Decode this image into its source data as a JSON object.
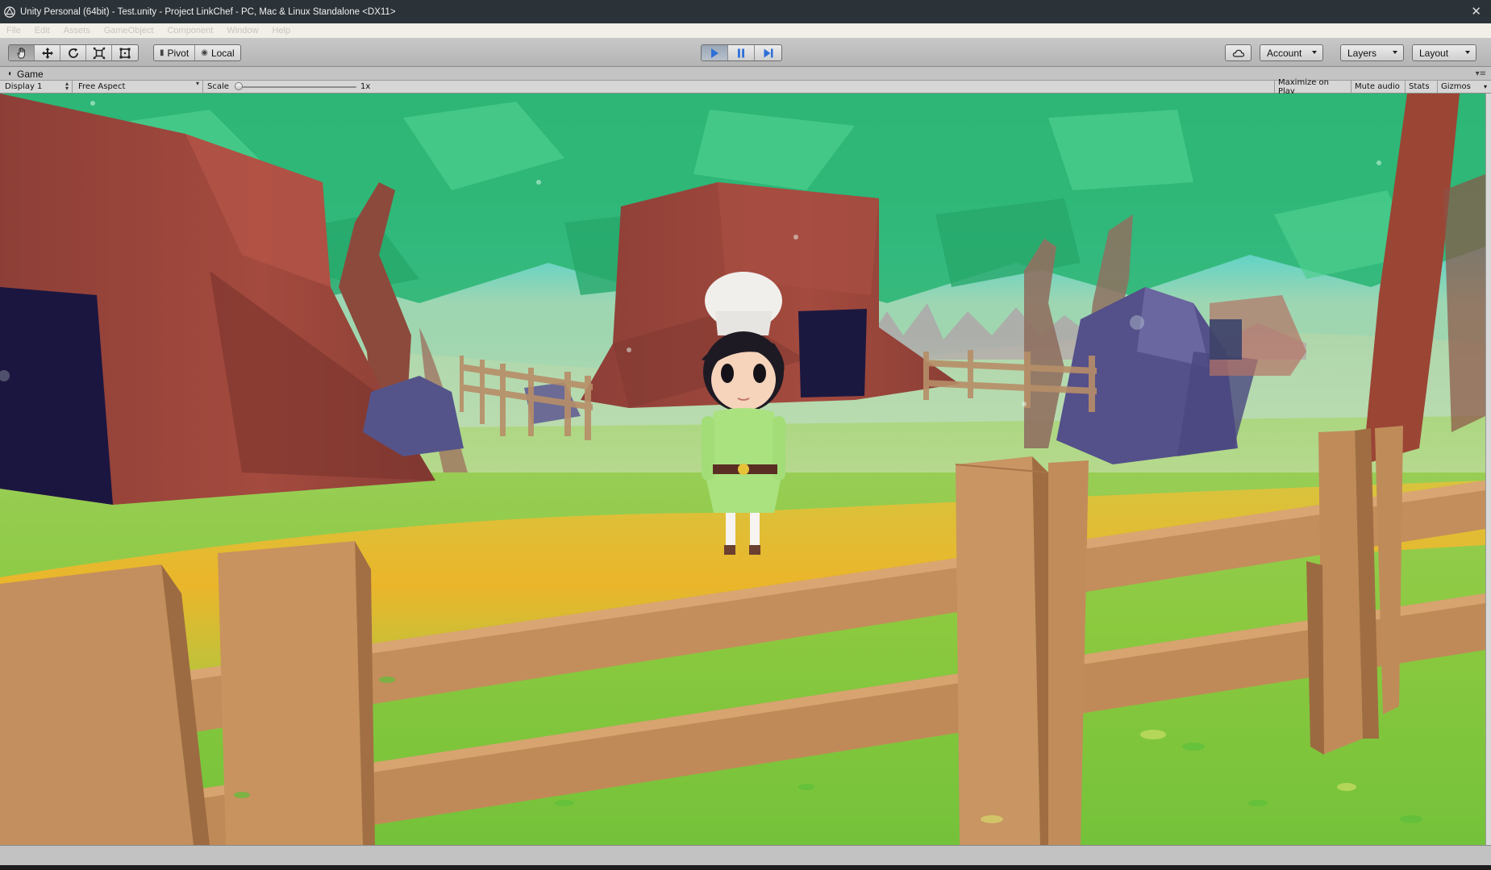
{
  "window": {
    "title": "Unity Personal (64bit) - Test.unity - Project LinkChef - PC, Mac & Linux Standalone <DX11>",
    "close_glyph": "✕"
  },
  "menu": {
    "items": [
      {
        "label": "File"
      },
      {
        "label": "Edit"
      },
      {
        "label": "Assets"
      },
      {
        "label": "GameObject"
      },
      {
        "label": "Component"
      },
      {
        "label": "Window"
      },
      {
        "label": "Help"
      }
    ]
  },
  "toolbar": {
    "tools": [
      {
        "name": "hand-tool",
        "icon": "hand-icon",
        "active": true
      },
      {
        "name": "move-tool",
        "icon": "move-icon",
        "active": false
      },
      {
        "name": "rotate-tool",
        "icon": "rotate-icon",
        "active": false
      },
      {
        "name": "scale-tool",
        "icon": "scale-icon",
        "active": false
      },
      {
        "name": "rect-tool",
        "icon": "rect-icon",
        "active": false
      }
    ],
    "pivot_label": "Pivot",
    "local_label": "Local",
    "play": {
      "playing": true,
      "accent": "#2e6fd8"
    },
    "account_label": "Account",
    "layers_label": "Layers",
    "layout_label": "Layout"
  },
  "game_view": {
    "tab_label": "Game",
    "display_label": "Display 1",
    "aspect_label": "Free Aspect",
    "scale_label": "Scale",
    "scale_value": "1x",
    "maximize_label": "Maximize on Play",
    "mute_label": "Mute audio",
    "stats_label": "Stats",
    "gizmos_label": "Gizmos"
  },
  "colors": {
    "sky_top": "#3cc07f",
    "grass": "#86c93c",
    "path": "#e9b92a",
    "fence": "#c48e5a",
    "stump": "#9a463c",
    "rock": "#5a5a8a"
  }
}
